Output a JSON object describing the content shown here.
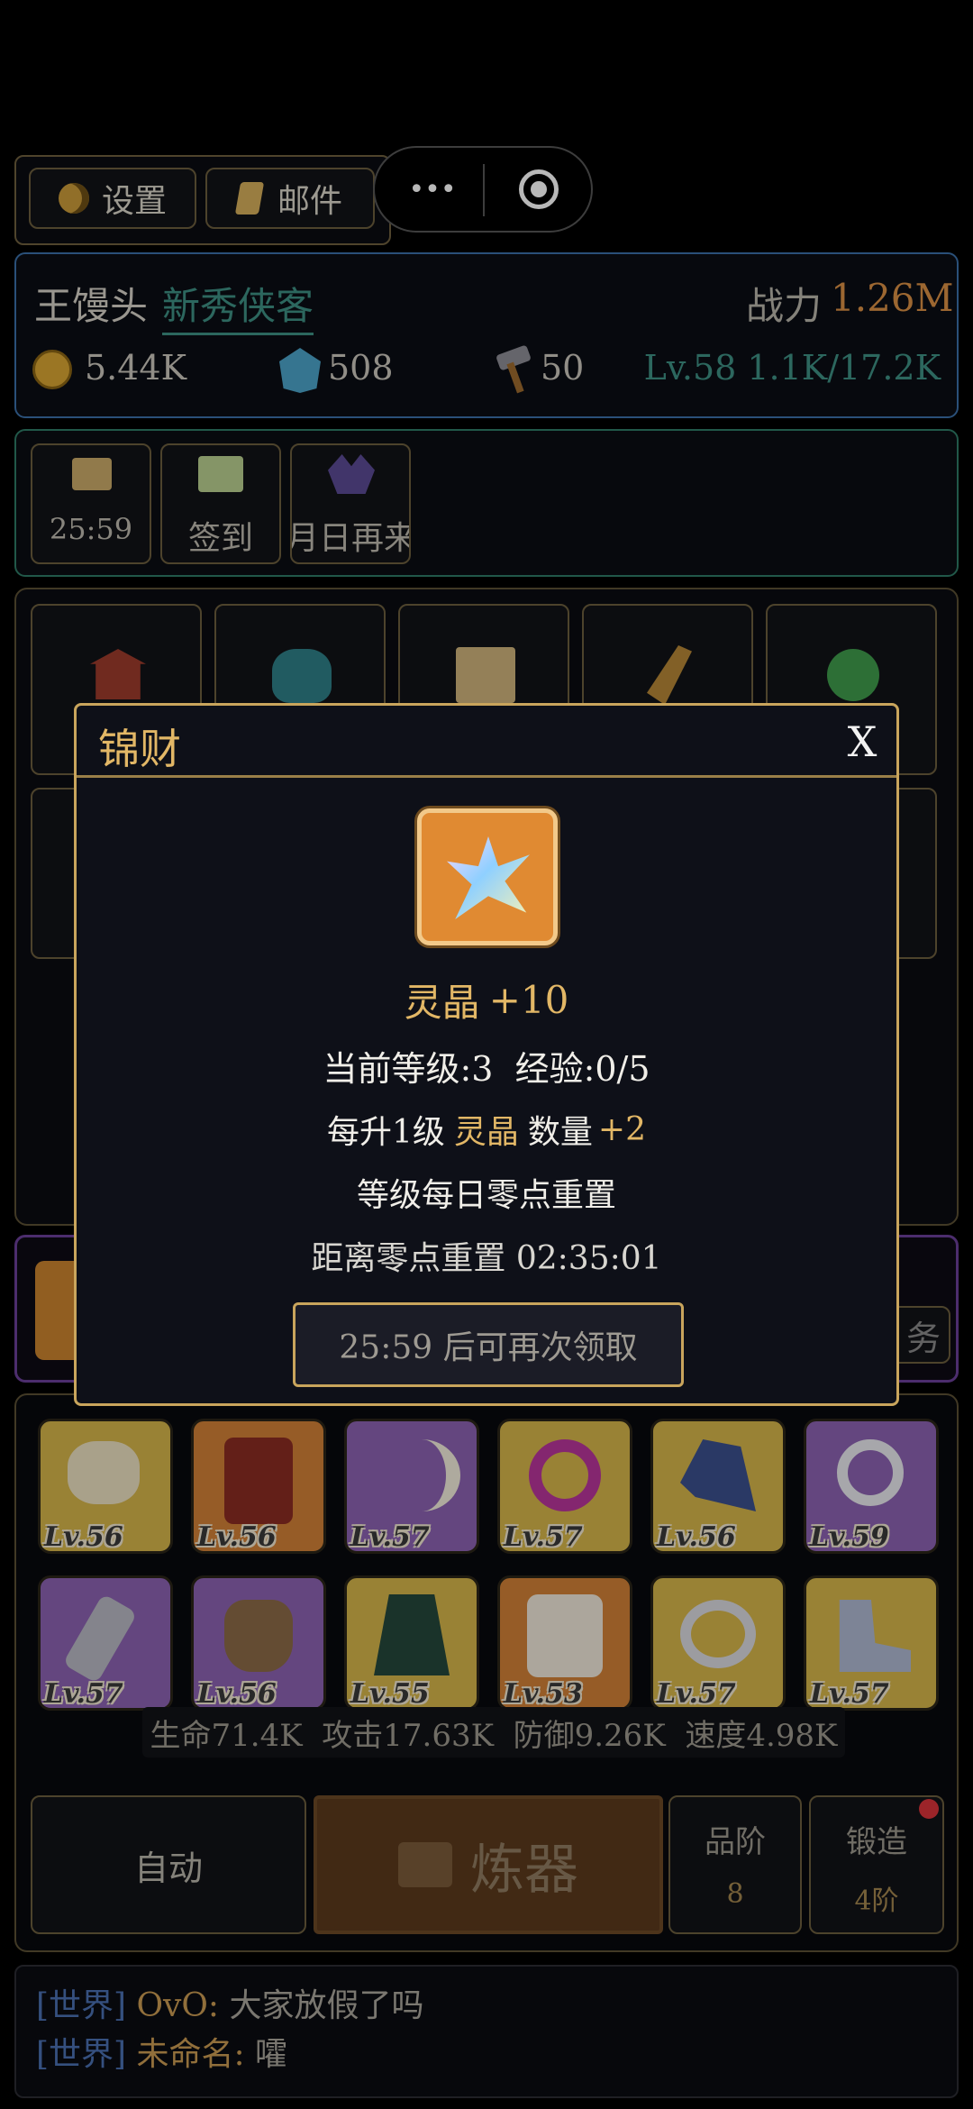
{
  "top": {
    "settings_label": "设置",
    "mail_label": "邮件",
    "more_glyph": "•••",
    "target_glyph": "◎"
  },
  "player": {
    "name": "王馒头",
    "title": "新秀侠客",
    "power_label": "战力",
    "power_value": "1.26M",
    "coins": "5.44K",
    "gems": "508",
    "hammers": "50",
    "level": "Lv.58 1.1K/17.2K"
  },
  "activities": [
    {
      "label": "25:59",
      "icon": "scroll-icon"
    },
    {
      "label": "签到",
      "icon": "checkin-icon"
    },
    {
      "label": "月日再来",
      "icon": "crystal-icon"
    }
  ],
  "modal": {
    "title": "锦财",
    "close": "X",
    "reward_name": "灵晶",
    "reward_amount": "+10",
    "level_line": "当前等级:3  经验:0/5",
    "per_level_prefix": "每升1级",
    "per_level_item": "灵晶",
    "per_level_mid": "数量",
    "per_level_amount": "+2",
    "reset_note": "等级每日零点重置",
    "countdown": "距离零点重置 02:35:01",
    "claim_button": "25:59 后可再次领取"
  },
  "equipment": [
    {
      "level": "Lv.56",
      "rarity": "yellow",
      "icon": "scarf-icon"
    },
    {
      "level": "Lv.56",
      "rarity": "orange",
      "icon": "robe-icon"
    },
    {
      "level": "Lv.57",
      "rarity": "purple",
      "icon": "blade-icon"
    },
    {
      "level": "Lv.57",
      "rarity": "yellow",
      "icon": "amulet-icon"
    },
    {
      "level": "Lv.56",
      "rarity": "yellow",
      "icon": "helmet-icon"
    },
    {
      "level": "Lv.59",
      "rarity": "purple",
      "icon": "necklace-icon"
    },
    {
      "level": "Lv.57",
      "rarity": "purple",
      "icon": "bracer-icon"
    },
    {
      "level": "Lv.56",
      "rarity": "purple",
      "icon": "glove-icon"
    },
    {
      "level": "Lv.55",
      "rarity": "yellow",
      "icon": "cloak-icon"
    },
    {
      "level": "Lv.53",
      "rarity": "orange",
      "icon": "vest-icon"
    },
    {
      "level": "Lv.57",
      "rarity": "yellow",
      "icon": "ring-icon"
    },
    {
      "level": "Lv.57",
      "rarity": "yellow",
      "icon": "boots-icon"
    }
  ],
  "stats": "生命71.4K  攻击17.63K  防御9.26K  速度4.98K",
  "actions": {
    "auto_label": "自动",
    "refine_label": "炼器",
    "grade_label": "品阶",
    "grade_value": "8",
    "forge_label": "锻造",
    "forge_value": "4阶"
  },
  "partial": {
    "right_button_glyph": "务"
  },
  "chat": [
    {
      "channel": "[世界]",
      "name": "OvO:",
      "text": "大家放假了吗"
    },
    {
      "channel": "[世界]",
      "name": "未命名:",
      "text": "嚯"
    }
  ],
  "colors": {
    "gold": "#e2b766",
    "teal": "#3d8f83",
    "modal_border": "#c9a55c",
    "chat_channel": "#4a6fb0",
    "chat_name": "#c99a52"
  }
}
